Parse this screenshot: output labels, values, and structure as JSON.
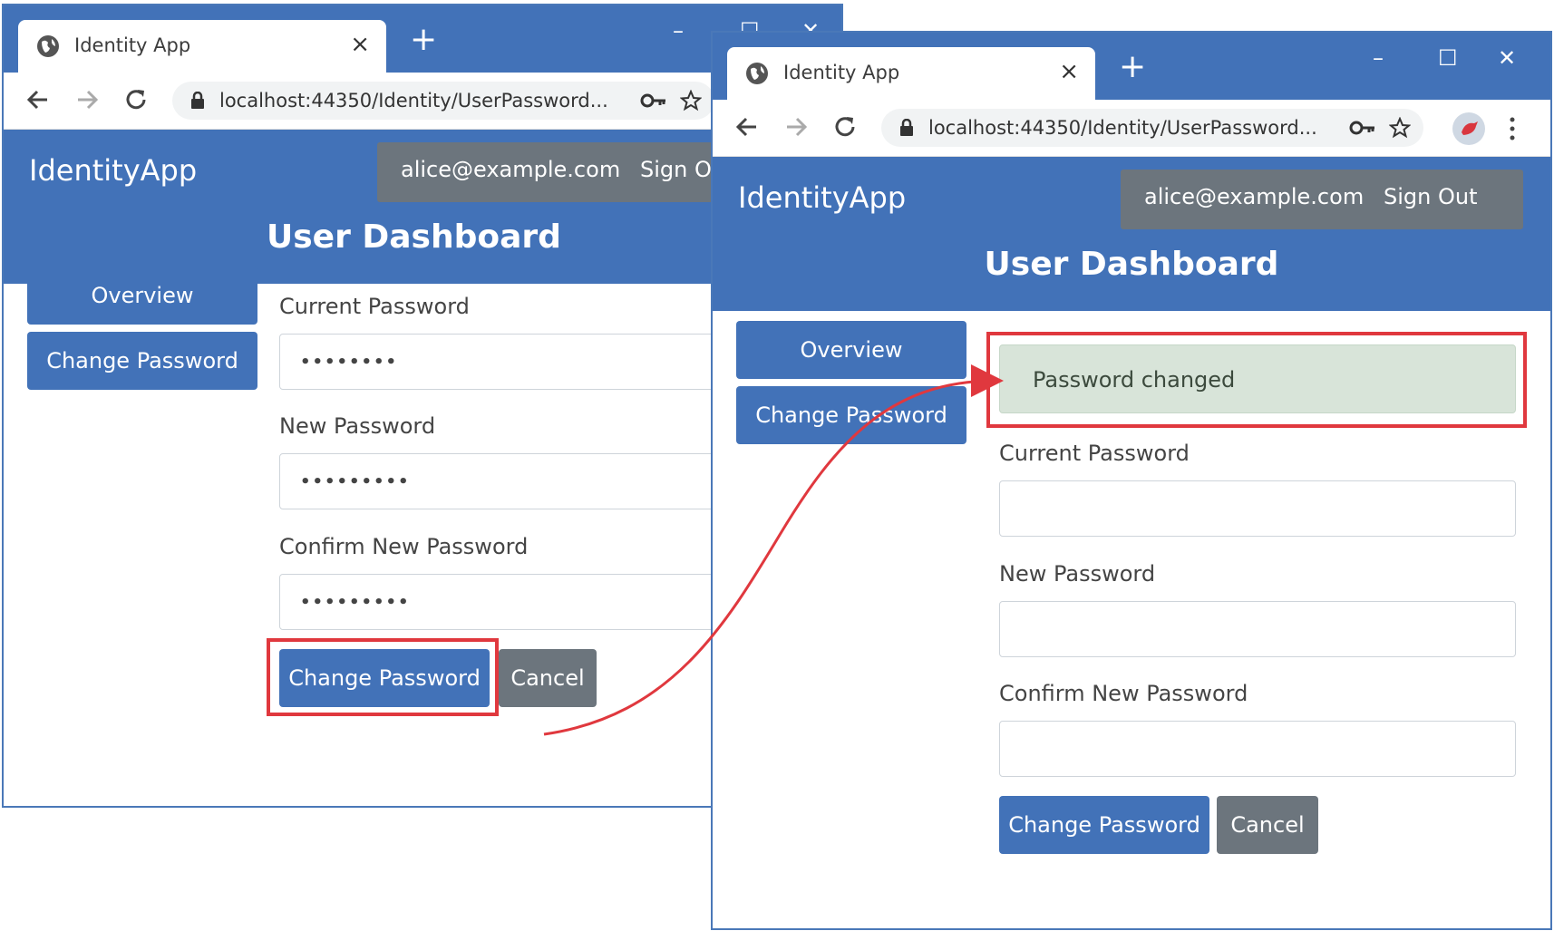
{
  "browser": {
    "tab_title": "Identity App",
    "tab_close": "×",
    "new_tab": "+",
    "url": "localhost:44350/Identity/UserPassword...",
    "minimize": "–",
    "maximize": "☐",
    "close": "✕"
  },
  "app": {
    "brand": "IdentityApp",
    "user_email": "alice@example.com",
    "sign_out": "Sign Out",
    "page_title": "User Dashboard"
  },
  "sidebar": {
    "overview": "Overview",
    "change_password": "Change Password"
  },
  "form": {
    "current_password_label": "Current Password",
    "new_password_label": "New Password",
    "confirm_password_label": "Confirm New Password",
    "submit_label": "Change Password",
    "cancel_label": "Cancel"
  },
  "window_before": {
    "current_password_value": "••••••••",
    "new_password_value": "•••••••••",
    "confirm_password_value": "•••••••••"
  },
  "window_after": {
    "alert_text": "Password changed",
    "current_password_value": "",
    "new_password_value": "",
    "confirm_password_value": ""
  },
  "colors": {
    "primary": "#4272b8",
    "secondary": "#6c757d",
    "success_bg": "#d8e4d9",
    "callout": "#e0383e"
  }
}
